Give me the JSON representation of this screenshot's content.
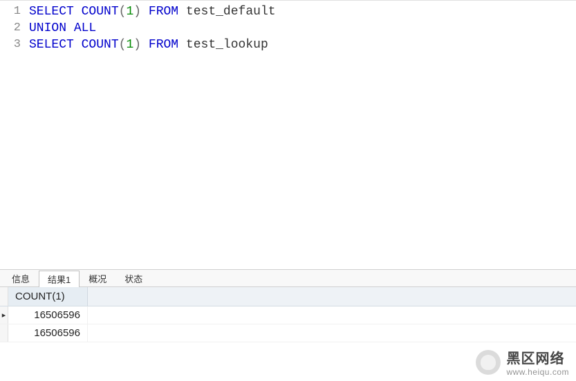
{
  "editor": {
    "lines": [
      {
        "num": "1",
        "tokens": [
          {
            "t": "kw",
            "v": "SELECT"
          },
          {
            "t": "sp",
            "v": " "
          },
          {
            "t": "kw",
            "v": "COUNT"
          },
          {
            "t": "paren",
            "v": "("
          },
          {
            "t": "num",
            "v": "1"
          },
          {
            "t": "paren",
            "v": ")"
          },
          {
            "t": "sp",
            "v": " "
          },
          {
            "t": "kw",
            "v": "FROM"
          },
          {
            "t": "sp",
            "v": " "
          },
          {
            "t": "ident",
            "v": "test_default"
          }
        ]
      },
      {
        "num": "2",
        "tokens": [
          {
            "t": "kw",
            "v": "UNION"
          },
          {
            "t": "sp",
            "v": " "
          },
          {
            "t": "kw",
            "v": "ALL"
          }
        ]
      },
      {
        "num": "3",
        "tokens": [
          {
            "t": "kw",
            "v": "SELECT"
          },
          {
            "t": "sp",
            "v": " "
          },
          {
            "t": "kw",
            "v": "COUNT"
          },
          {
            "t": "paren",
            "v": "("
          },
          {
            "t": "num",
            "v": "1"
          },
          {
            "t": "paren",
            "v": ")"
          },
          {
            "t": "sp",
            "v": " "
          },
          {
            "t": "kw",
            "v": "FROM"
          },
          {
            "t": "sp",
            "v": " "
          },
          {
            "t": "ident",
            "v": "test_lookup"
          }
        ]
      }
    ]
  },
  "tabs": {
    "items": [
      {
        "label": "信息",
        "active": false
      },
      {
        "label": "结果1",
        "active": true
      },
      {
        "label": "概况",
        "active": false
      },
      {
        "label": "状态",
        "active": false
      }
    ]
  },
  "results": {
    "columns": [
      "COUNT(1)"
    ],
    "rows": [
      {
        "indicator": "▸",
        "cells": [
          "16506596"
        ]
      },
      {
        "indicator": "",
        "cells": [
          "16506596"
        ]
      }
    ]
  },
  "watermark": {
    "title": "黑区网络",
    "url": "www.heiqu.com"
  }
}
